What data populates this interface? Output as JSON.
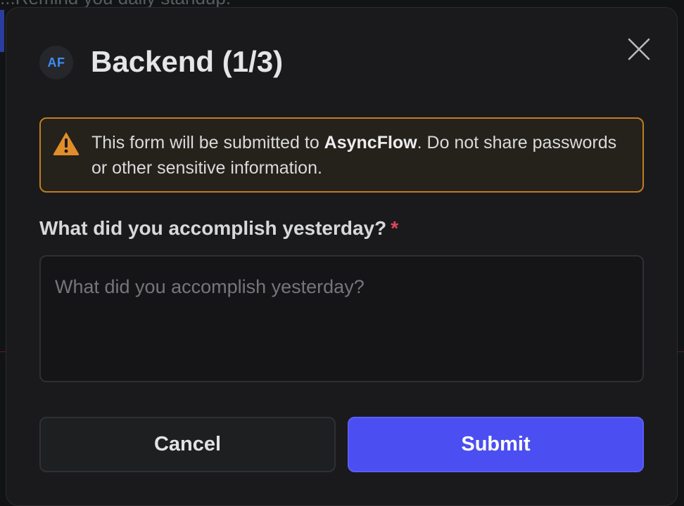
{
  "background": {
    "top_text": "...Remind you daily standup."
  },
  "dialog": {
    "avatar_initials": "AF",
    "title": "Backend (1/3)",
    "close_icon": "close-icon",
    "warning": {
      "icon": "warning-icon",
      "text_before": "This form will be submitted to ",
      "app_name": "AsyncFlow",
      "text_after": ". Do not share passwords or other sensitive information."
    },
    "question": {
      "label": "What did you accomplish yesterday?",
      "required_marker": "*",
      "placeholder": "What did you accomplish yesterday?",
      "value": ""
    },
    "cancel_label": "Cancel",
    "submit_label": "Submit"
  },
  "colors": {
    "accent": "#4b4ef0",
    "warning_border": "#c27c22",
    "required": "#e0475a",
    "avatar_text": "#3e8cf5"
  }
}
